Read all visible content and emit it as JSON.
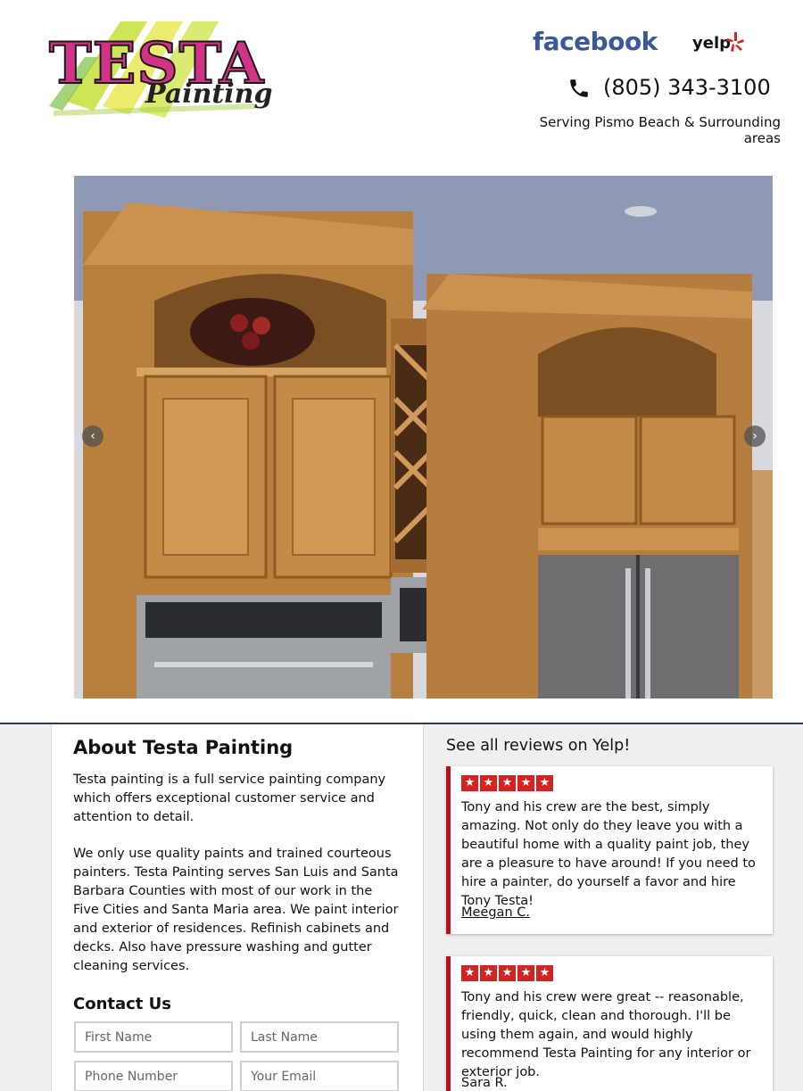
{
  "header": {
    "logo_title": "TESTA",
    "logo_subtitle": "Painting",
    "facebook_label": "facebook",
    "yelp_label": "yelp",
    "phone": "(805) 343-3100",
    "serving": "Serving Pismo Beach & Surrounding areas"
  },
  "carousel": {
    "prev_glyph": "‹",
    "next_glyph": "›"
  },
  "about": {
    "title": "About Testa Painting",
    "paragraph1": "Testa painting is a full service painting company which offers exceptional customer service and attention to detail.",
    "paragraph2": "We only use quality paints and trained courteous painters. Testa Painting serves San Luis and Santa Barbara Counties with most of our work in the Five Cities and Santa Maria area. We paint interior and exterior of residences. Refinish cabinets and decks. Also have pressure washing and gutter cleaning services."
  },
  "contact": {
    "title": "Contact Us",
    "first_name_placeholder": "First Name",
    "last_name_placeholder": "Last Name",
    "phone_placeholder": "Phone Number",
    "email_placeholder": "Your Email"
  },
  "reviews": {
    "title": "See all reviews on Yelp!",
    "star_glyph": "★",
    "items": [
      {
        "rating": 5,
        "text": "Tony and his crew are the best, simply amazing. Not only do they leave you with a beautiful home with a quality paint job, they are a pleasure to have around! If you need to hire a painter, do yourself a favor and hire Tony Testa!",
        "author": "Meegan C."
      },
      {
        "rating": 5,
        "text": "Tony and his crew were great -- reasonable, friendly, quick, clean and thorough. I'll be using them again, and would highly recommend Testa Painting for any interior or exterior job.",
        "author": "Sara R."
      }
    ]
  },
  "colors": {
    "facebook_blue": "#3b5998",
    "yelp_red": "#d32323",
    "review_accent": "#b7131a",
    "logo_pink": "#d13386"
  },
  "icons": {
    "phone": "phone-icon",
    "yelp_burst": "yelp-burst-icon",
    "star": "star-icon"
  }
}
